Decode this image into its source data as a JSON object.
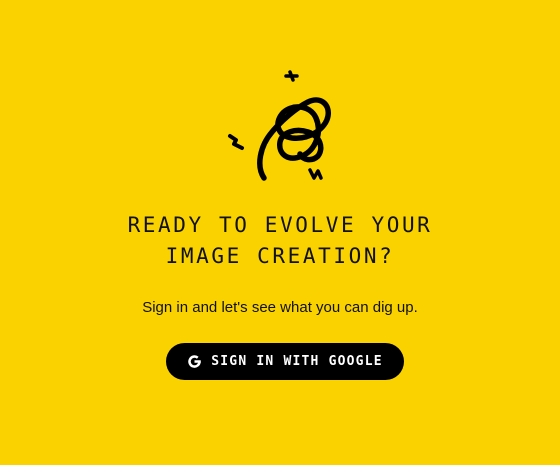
{
  "theme": {
    "background": "#F9D200",
    "button_background": "#000000",
    "button_text": "#FFFFFF"
  },
  "hero": {
    "illustration_icon": "squiggle-spiral-sparkles-icon",
    "headline_line1": "READY TO EVOLVE YOUR",
    "headline_line2": "IMAGE CREATION?",
    "subtitle": "Sign in and let's see what you can dig up."
  },
  "signin": {
    "icon": "google-g-icon",
    "label": "SIGN IN WITH GOOGLE"
  }
}
